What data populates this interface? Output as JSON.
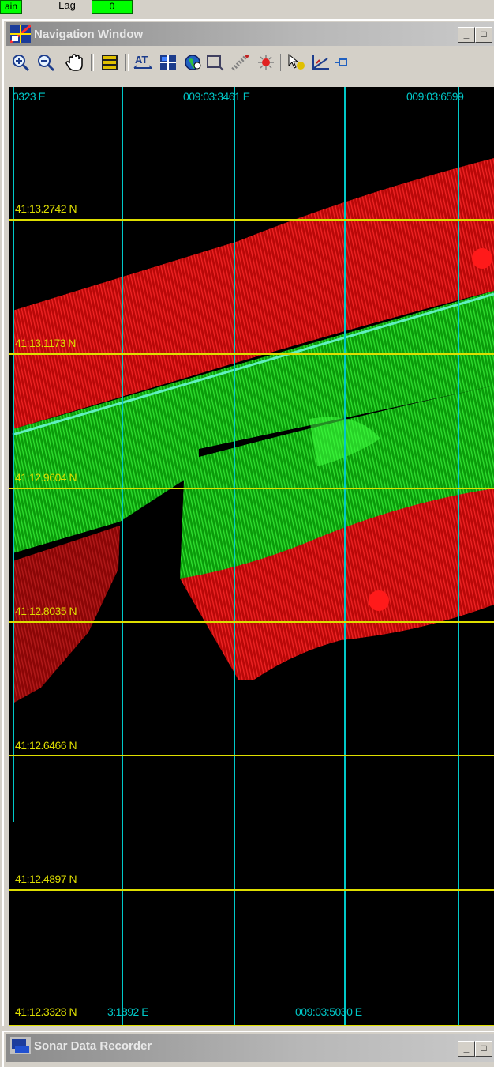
{
  "top_strip": {
    "left_chip": "ain",
    "lag_label": "Lag",
    "lag_value": "0"
  },
  "nav_window": {
    "title": "Navigation Window",
    "minimize": "_",
    "restore": "□",
    "toolbar": [
      {
        "name": "zoom-in-icon"
      },
      {
        "name": "zoom-out-icon"
      },
      {
        "name": "pan-hand-icon"
      },
      {
        "name": "layers-icon"
      },
      {
        "name": "annotation-text-icon"
      },
      {
        "name": "grid-icon"
      },
      {
        "name": "globe-icon"
      },
      {
        "name": "select-rect-icon"
      },
      {
        "name": "track-icon"
      },
      {
        "name": "target-icon"
      },
      {
        "name": "pointer-icon"
      },
      {
        "name": "measure-icon"
      },
      {
        "name": "marker-icon"
      }
    ],
    "lon_top": [
      "0323 E",
      "009:03:3461 E",
      "009:03:6599"
    ],
    "lon_bottom": [
      "3:1892 E",
      "009:03:5030 E"
    ],
    "lat_labels": [
      "41:13.2742 N",
      "41:13.1173 N",
      "41:12.9604 N",
      "41:12.8035 N",
      "41:12.6466 N",
      "41:12.4897 N",
      "41:12.3328 N"
    ],
    "colors": {
      "lat_grid": "#dede00",
      "lon_grid": "#00c8c8",
      "swath_red": "#d21010",
      "swath_green": "#10c010"
    }
  },
  "sonar_window": {
    "title": "Sonar Data Recorder",
    "minimize": "_",
    "restore": "□"
  }
}
